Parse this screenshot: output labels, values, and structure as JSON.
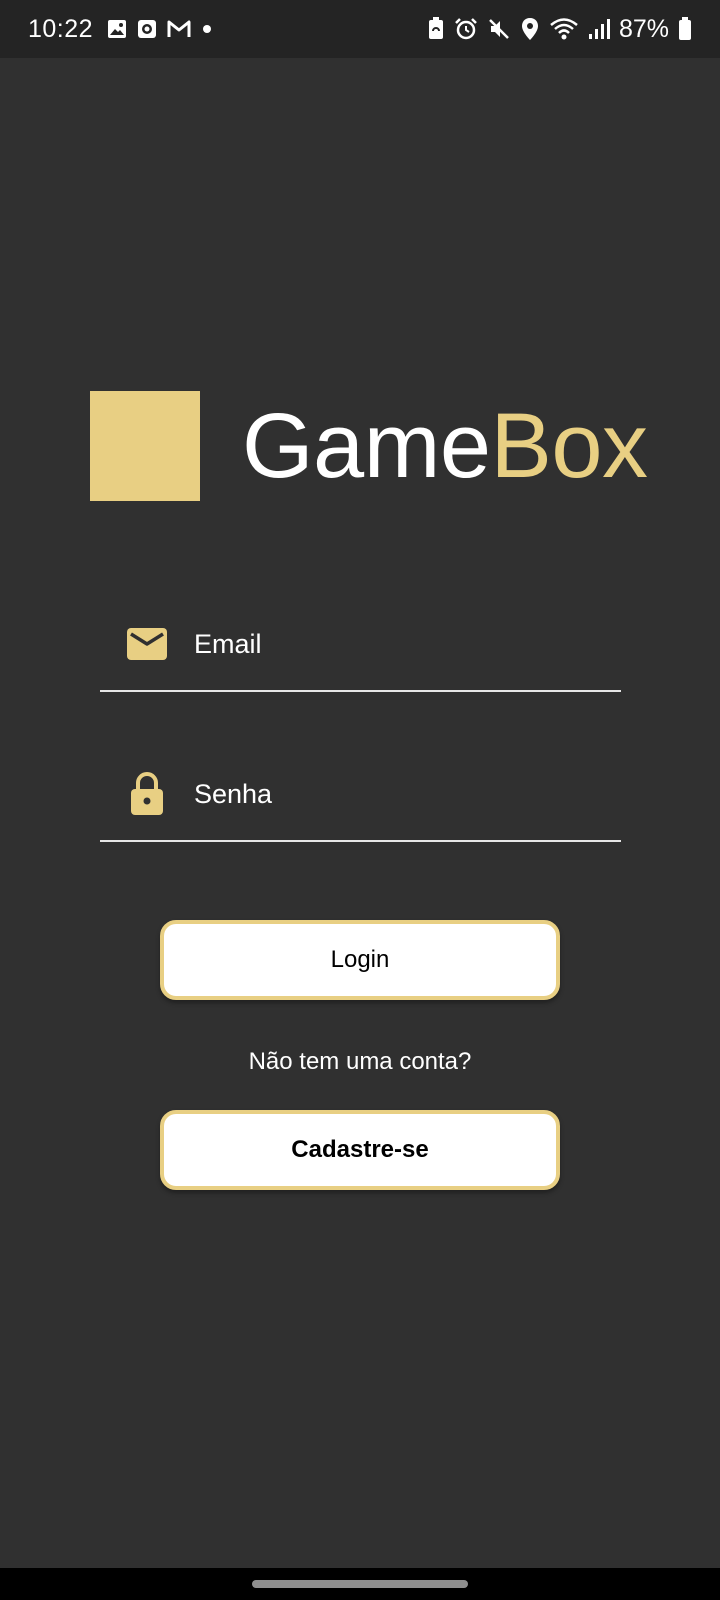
{
  "status_bar": {
    "time": "10:22",
    "battery": "87%",
    "notification_icons": [
      "gallery-icon",
      "screen-recorder-icon",
      "gmail-icon",
      "more-dot-icon"
    ],
    "system_icons": [
      "battery-saver-icon",
      "alarm-icon",
      "mute-icon",
      "location-icon",
      "wifi-icon",
      "signal-icon",
      "battery-icon"
    ]
  },
  "logo": {
    "word_main": "Game",
    "word_accent": "Box"
  },
  "form": {
    "email_placeholder": "Email",
    "email_value": "",
    "password_placeholder": "Senha",
    "password_value": "",
    "email_icon": "mail-icon",
    "password_icon": "lock-icon"
  },
  "actions": {
    "login_label": "Login",
    "no_account_text": "Não tem uma conta?",
    "signup_label": "Cadastre-se"
  },
  "colors": {
    "background": "#303030",
    "accent": "#e8cf83",
    "button_bg": "#ffffff",
    "text": "#ffffff"
  }
}
